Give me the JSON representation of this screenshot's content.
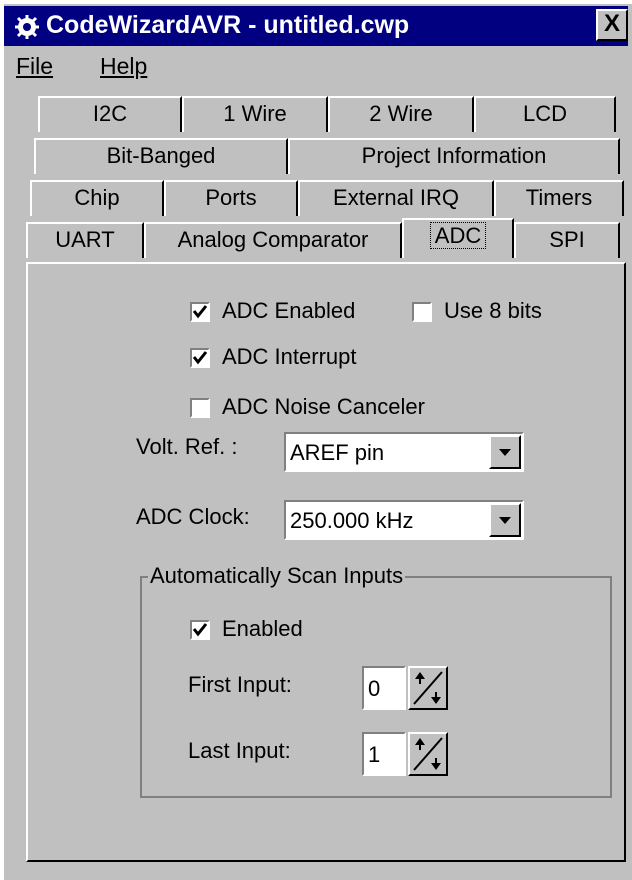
{
  "window": {
    "title": "CodeWizardAVR - untitled.cwp",
    "close_label": "X"
  },
  "menu": {
    "file": "File",
    "help": "Help"
  },
  "tabs": {
    "row1": [
      "I2C",
      "1 Wire",
      "2 Wire",
      "LCD"
    ],
    "row2": [
      "Bit-Banged",
      "Project Information"
    ],
    "row3": [
      "Chip",
      "Ports",
      "External IRQ",
      "Timers"
    ],
    "row4": [
      "UART",
      "Analog Comparator",
      "ADC",
      "SPI"
    ],
    "active": "ADC"
  },
  "adc": {
    "enabled": {
      "label": "ADC Enabled",
      "checked": true
    },
    "use8bits": {
      "label": "Use 8 bits",
      "checked": false
    },
    "interrupt": {
      "label": "ADC Interrupt",
      "checked": true
    },
    "noise": {
      "label": "ADC Noise Canceler",
      "checked": false
    },
    "volt_ref": {
      "label": "Volt. Ref. :",
      "value": "AREF pin"
    },
    "clock": {
      "label": "ADC Clock:",
      "value": "250.000 kHz"
    }
  },
  "scan": {
    "title": "Automatically Scan Inputs",
    "enabled": {
      "label": "Enabled",
      "checked": true
    },
    "first": {
      "label": "First Input:",
      "value": "0"
    },
    "last": {
      "label": "Last Input:",
      "value": "1"
    }
  },
  "colors": {
    "titlebar": "#000080",
    "face": "#c0c0c0"
  },
  "icons": {
    "app": "gear-icon",
    "combo_arrow": "chevron-down-icon",
    "spin": "spin-up-down-icon",
    "check": "check-icon"
  }
}
